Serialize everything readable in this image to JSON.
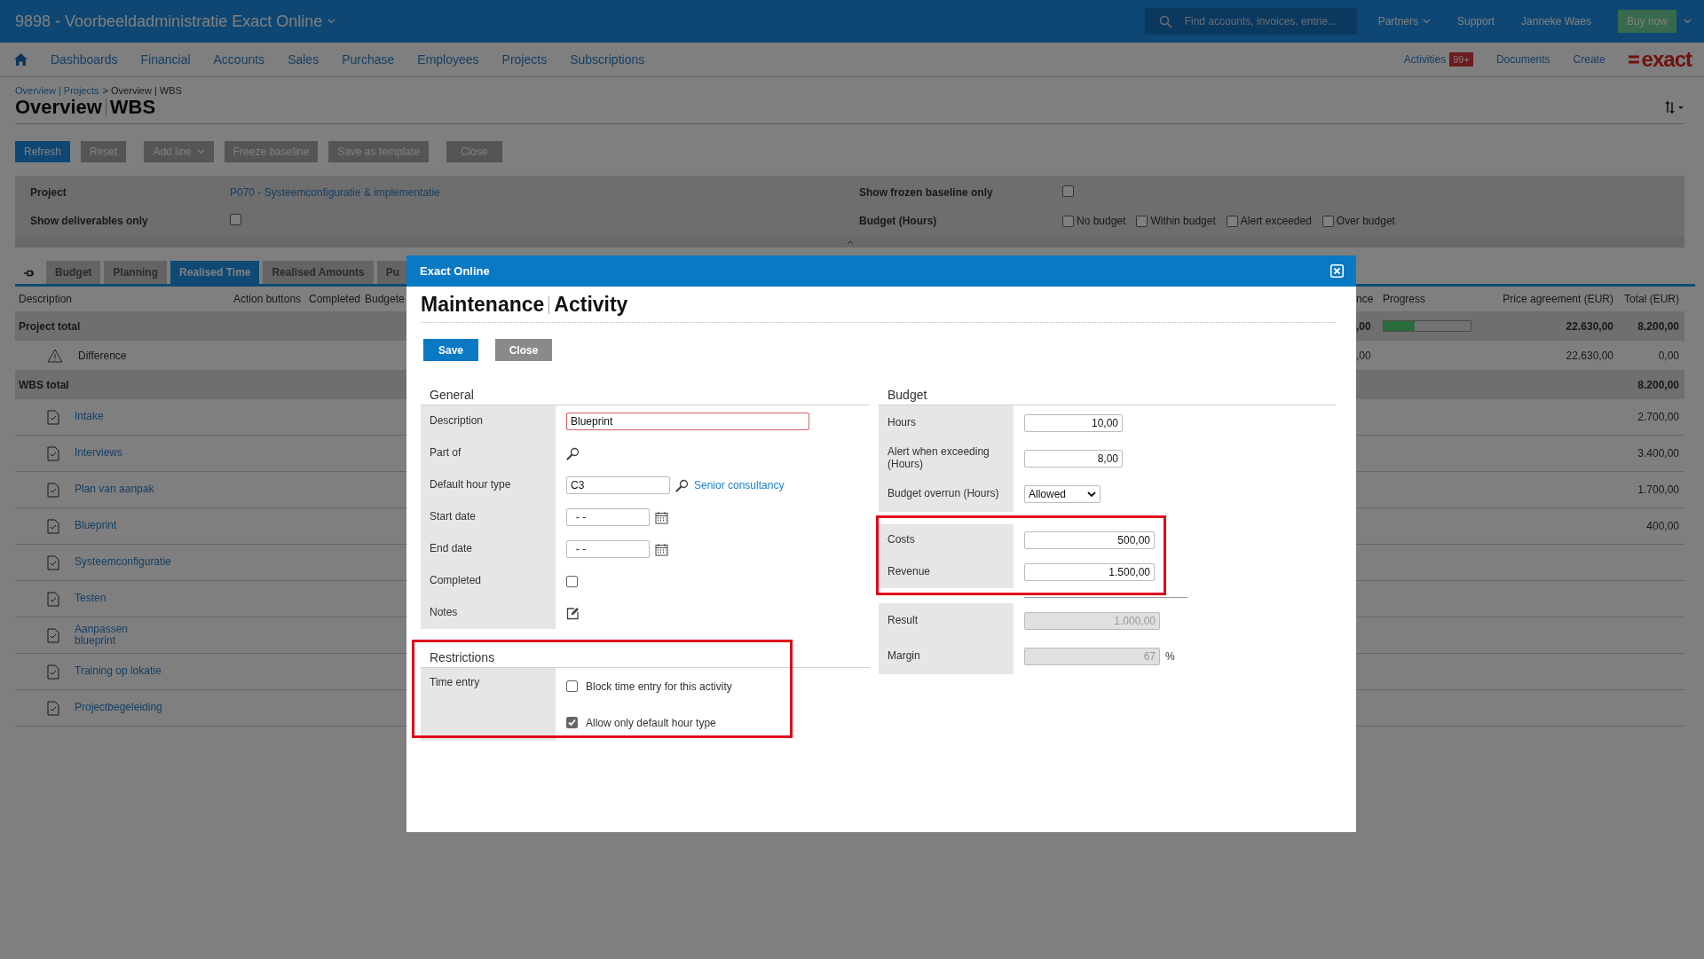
{
  "header": {
    "title": "9898 - Voorbeeldadministratie Exact Online",
    "search": {
      "placeholder": "Find accounts, invoices, entrie..."
    },
    "links": [
      {
        "label": "Partners",
        "dropdown": true
      },
      {
        "label": "Support",
        "dropdown": false
      },
      {
        "label": "Janneke Waes",
        "dropdown": false
      }
    ],
    "buy_button": "Buy now"
  },
  "nav": {
    "items": [
      "Dashboards",
      "Financial",
      "Accounts",
      "Sales",
      "Purchase",
      "Employees",
      "Projects",
      "Subscriptions"
    ],
    "right": [
      {
        "label": "Activities",
        "badge": "99+"
      },
      {
        "label": "Documents"
      },
      {
        "label": "Create"
      }
    ],
    "logo": "exact"
  },
  "page": {
    "breadcrumb": [
      {
        "label": "Overview | Projects",
        "link": true
      },
      {
        "label": "> Overview | WBS",
        "link": false
      }
    ],
    "title": [
      "Overview",
      "WBS"
    ],
    "toolbar": [
      {
        "label": "Refresh",
        "primary": true,
        "dropdown": false
      },
      {
        "label": "Reset",
        "primary": false,
        "dropdown": false
      },
      {
        "label": "Add line",
        "primary": false,
        "dropdown": true
      },
      {
        "label": "Freeze baseline",
        "primary": false,
        "dropdown": false
      },
      {
        "label": "Save as template",
        "primary": false,
        "dropdown": false
      },
      {
        "label": "Close",
        "primary": false,
        "dropdown": false
      }
    ]
  },
  "filters": {
    "project": {
      "label": "Project",
      "value": "P070 - Systeemconfiguratie & implementatie"
    },
    "deliverables": {
      "label": "Show deliverables only",
      "checked": false
    },
    "frozen": {
      "label": "Show frozen baseline only",
      "checked": false
    },
    "budget": {
      "label": "Budget (Hours)",
      "options": [
        {
          "label": "No budget",
          "checked": false
        },
        {
          "label": "Within budget",
          "checked": false
        },
        {
          "label": "Alert exceeded",
          "checked": false
        },
        {
          "label": "Over budget",
          "checked": false
        }
      ]
    }
  },
  "tabs": [
    {
      "label": "Budget",
      "selected": false
    },
    {
      "label": "Planning",
      "selected": false
    },
    {
      "label": "Realised Time",
      "selected": true
    },
    {
      "label": "Realised Amounts",
      "selected": false
    },
    {
      "label": "Pu",
      "selected": false
    }
  ],
  "table": {
    "columns_left": [
      "Description",
      "Action buttons",
      "Completed",
      "Budgete"
    ],
    "columns_right": [
      "nce",
      "Progress",
      "Price agreement (EUR)",
      "Total (EUR)"
    ],
    "rows": [
      {
        "kind": "total",
        "description": "Project total",
        "column_5": ",00",
        "level": 0.36,
        "price_agreement": "22.630,00",
        "total": "8.200,00"
      },
      {
        "kind": "warning",
        "description": "Difference",
        "column_5": ",00",
        "price_agreement": "22.630,00",
        "total": "0,00"
      },
      {
        "kind": "total",
        "description": "WBS total",
        "total": "8.200,00"
      },
      {
        "kind": "activity",
        "description": "Intake",
        "total": "2.700,00"
      },
      {
        "kind": "activity",
        "description": "Interviews",
        "total": "3.400,00"
      },
      {
        "kind": "activity",
        "description": "Plan van aanpak",
        "total": "1.700,00"
      },
      {
        "kind": "activity",
        "description": "Blueprint",
        "total": "400,00"
      },
      {
        "kind": "activity",
        "description": "Systeemconfiguratie"
      },
      {
        "kind": "activity",
        "description": "Testen"
      },
      {
        "kind": "activity",
        "description": "Aanpassen\nblueprint"
      },
      {
        "kind": "activity",
        "description": "Training op lokatie"
      },
      {
        "kind": "activity",
        "description": "Projectbegeleiding"
      }
    ]
  },
  "dialog": {
    "title": "Exact Online",
    "heading": [
      "Maintenance",
      "Activity"
    ],
    "buttons": [
      {
        "label": "Save",
        "primary": true
      },
      {
        "label": "Close",
        "primary": false
      }
    ],
    "general": {
      "title": "General",
      "fields": [
        {
          "label": "Description",
          "kind": "text",
          "value": "Blueprint",
          "required": true
        },
        {
          "label": "Part of",
          "kind": "lookup"
        },
        {
          "label": "Default hour type",
          "kind": "code_lookup",
          "value": "C3",
          "link": "Senior consultancy"
        },
        {
          "label": "Start date",
          "kind": "date",
          "value": "- -"
        },
        {
          "label": "End date",
          "kind": "date",
          "value": "- -"
        },
        {
          "label": "Completed",
          "kind": "checkbox",
          "checked": false
        },
        {
          "label": "Notes",
          "kind": "notes"
        }
      ]
    },
    "restrictions": {
      "title": "Restrictions",
      "highlighted": true,
      "label": "Time entry",
      "options": [
        {
          "label": "Block time entry for this activity",
          "checked": false
        },
        {
          "label": "Allow only default hour type",
          "checked": true
        }
      ]
    },
    "budget": {
      "title": "Budget",
      "groups": [
        {
          "highlighted": false,
          "fields": [
            {
              "label": "Hours",
              "kind": "number",
              "value": "10,00"
            },
            {
              "label": "Alert when exceeding (Hours)",
              "kind": "number",
              "value": "8,00"
            },
            {
              "label": "Budget overrun (Hours)",
              "kind": "select",
              "value": "Allowed"
            }
          ]
        },
        {
          "highlighted": true,
          "fields": [
            {
              "label": "Costs",
              "kind": "amount",
              "value": "500,00"
            },
            {
              "label": "Revenue",
              "kind": "amount",
              "value": "1.500,00"
            }
          ]
        },
        {
          "highlighted": false,
          "fields": [
            {
              "label": "Result",
              "kind": "readonly",
              "value": "1.000,00"
            },
            {
              "label": "Margin",
              "kind": "readonly",
              "value": "67",
              "unit": "%"
            }
          ]
        }
      ]
    }
  }
}
